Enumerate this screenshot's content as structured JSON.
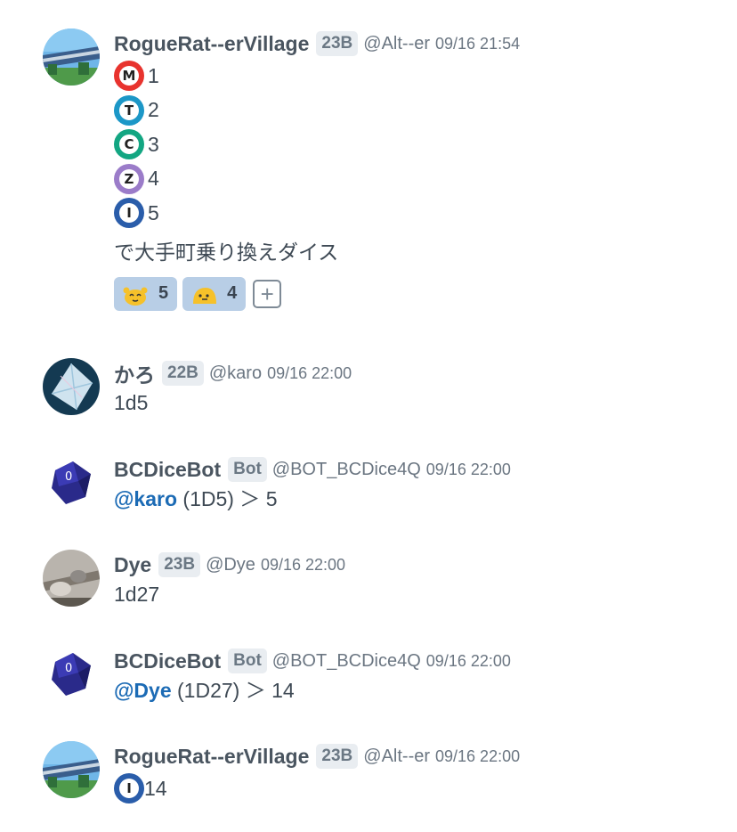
{
  "colors": {
    "metro_m": "#e8332e",
    "metro_t": "#1c97c7",
    "metro_c": "#13a682",
    "metro_z": "#9b7cc9",
    "metro_i": "#2a5daa",
    "mention": "#1c6bb5",
    "reaction_bg": "#b8cee6"
  },
  "messages": [
    {
      "username": "RogueRat--erVillage",
      "grade": "23B",
      "handle": "@Alt--er",
      "time": "09/16 21:54",
      "lines": [
        {
          "stamp": "M",
          "icon": "tokyo-metro-marunouchi-icon",
          "text": "1"
        },
        {
          "stamp": "T",
          "icon": "tokyo-metro-tozai-icon",
          "text": "2"
        },
        {
          "stamp": "C",
          "icon": "tokyo-metro-chiyoda-icon",
          "text": "3"
        },
        {
          "stamp": "Z",
          "icon": "tokyo-metro-hanzomon-icon",
          "text": "4"
        },
        {
          "stamp": "I",
          "icon": "toei-mita-icon",
          "text": "5"
        }
      ],
      "text": "で大手町乗り換えダイス",
      "reactions": [
        {
          "icon": "yellow-blob-cheer-icon",
          "count": "5"
        },
        {
          "icon": "yellow-blob-sleepy-icon",
          "count": "4"
        }
      ]
    },
    {
      "username": "かろ",
      "grade": "22B",
      "handle": "@karo",
      "time": "09/16 22:00",
      "text": "1d5"
    },
    {
      "username": "BCDiceBot",
      "grade": "Bot",
      "handle": "@BOT_BCDice4Q",
      "time": "09/16 22:00",
      "mention": "@karo",
      "text": " (1D5) ＞ 5"
    },
    {
      "username": "Dye",
      "grade": "23B",
      "handle": "@Dye",
      "time": "09/16 22:00",
      "text": "1d27"
    },
    {
      "username": "BCDiceBot",
      "grade": "Bot",
      "handle": "@BOT_BCDice4Q",
      "time": "09/16 22:00",
      "mention": "@Dye",
      "text": " (1D27) ＞ 14"
    },
    {
      "username": "RogueRat--erVillage",
      "grade": "23B",
      "handle": "@Alt--er",
      "time": "09/16 22:00",
      "stamp": "I",
      "text": "14"
    }
  ]
}
